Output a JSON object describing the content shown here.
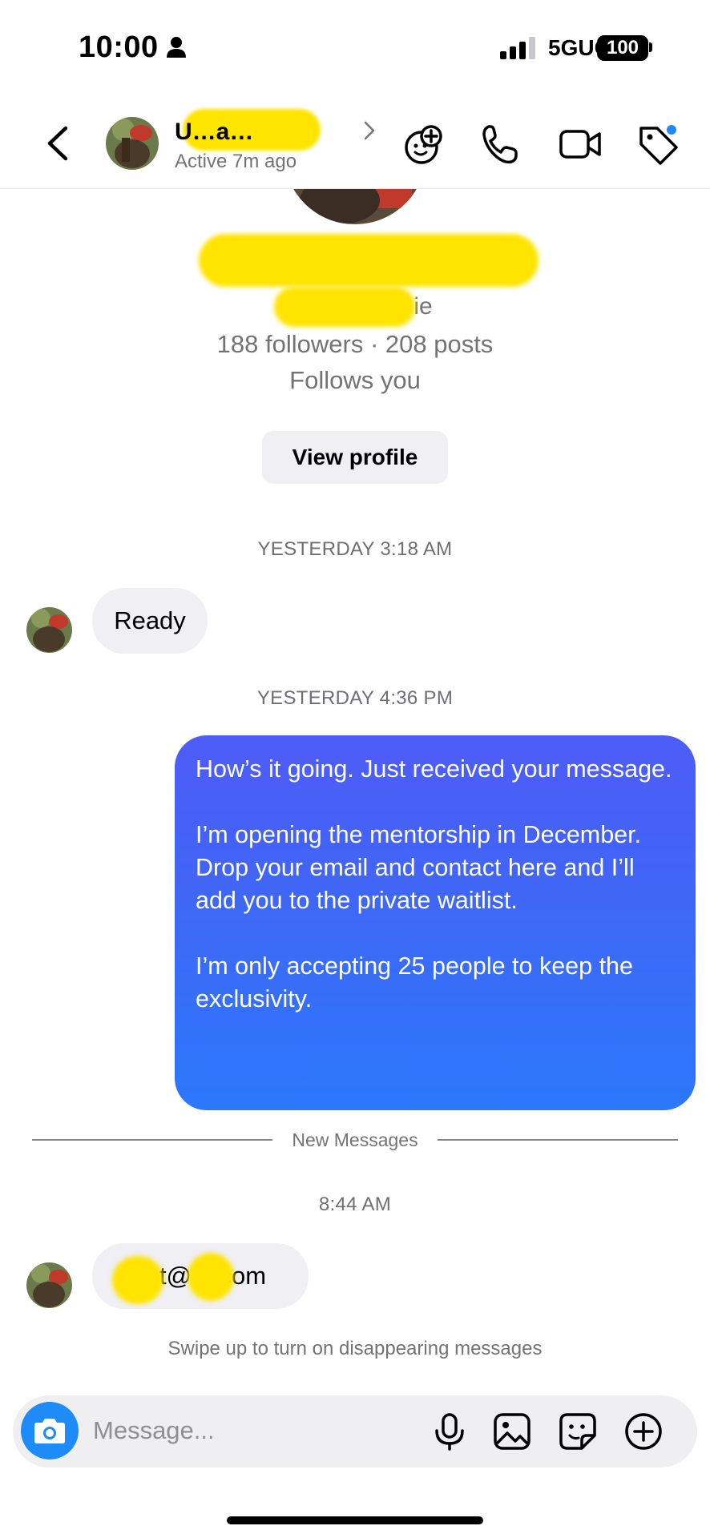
{
  "status_bar": {
    "time": "10:00",
    "network": "5GUC",
    "battery": "100"
  },
  "header": {
    "contact_name": "U…a…",
    "status": "Active 7m ago"
  },
  "profile": {
    "username_suffix": "ie",
    "stats": "188 followers · 208 posts",
    "follows_you": "Follows you",
    "view_profile_label": "View profile"
  },
  "conversation": {
    "timestamp_1": "YESTERDAY 3:18 AM",
    "message_1": "Ready",
    "timestamp_2": "YESTERDAY 4:36 PM",
    "outgoing_paragraphs": [
      "How’s it going. Just received your message.",
      "I’m opening the mentorship in December. Drop your email and contact here and I’ll add you to the private waitlist.",
      "I’m only accepting 25 people to keep the exclusivity."
    ],
    "new_messages_label": "New Messages",
    "timestamp_3": "8:44 AM",
    "message_2": "U  t@  e.com",
    "swipe_hint": "Swipe up to turn on disappearing messages"
  },
  "composer": {
    "placeholder": "Message..."
  },
  "icons": {
    "back": "chevron-left-icon",
    "add_face": "add-face-icon",
    "call": "phone-icon",
    "video": "video-camera-icon",
    "tag": "tag-icon",
    "camera": "camera-icon",
    "mic": "microphone-icon",
    "gallery": "image-icon",
    "sticker": "sticker-icon",
    "more": "plus-circle-icon"
  },
  "colors": {
    "accent_blue": "#1d8cf8",
    "bubble_gradient_top": "#4e5cf7",
    "bubble_gradient_bottom": "#2b78fb",
    "incoming_bubble": "#efeff4",
    "secondary_text": "#737373"
  }
}
